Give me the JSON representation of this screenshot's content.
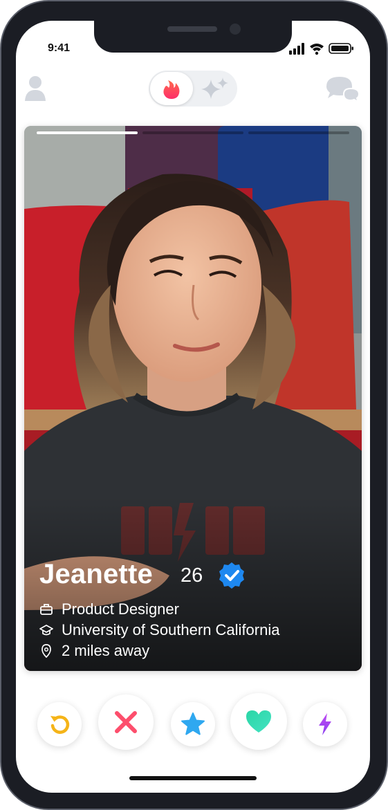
{
  "status_bar": {
    "time": "9:41"
  },
  "header": {
    "left_icon": "profile-icon",
    "toggle_left_icon": "flame-icon",
    "toggle_right_icon": "sparkle-icon",
    "right_icon": "messages-icon"
  },
  "card": {
    "progress": {
      "segments": 3,
      "active": 1
    },
    "name": "Jeanette",
    "age": "26",
    "verified": true,
    "details": [
      {
        "icon": "briefcase-icon",
        "text": "Product Designer"
      },
      {
        "icon": "graduation-cap-icon",
        "text": "University of Southern California"
      },
      {
        "icon": "location-pin-icon",
        "text": "2 miles away"
      }
    ]
  },
  "actions": [
    {
      "name": "rewind",
      "icon": "rewind-icon",
      "color": "#f5b418"
    },
    {
      "name": "nope",
      "icon": "close-icon",
      "color": "#fd4e6c"
    },
    {
      "name": "super-like",
      "icon": "star-icon",
      "color": "#2fa8f0"
    },
    {
      "name": "like",
      "icon": "heart-icon",
      "color": "#2ad6a6"
    },
    {
      "name": "boost",
      "icon": "lightning-icon",
      "color": "#a44ff0"
    }
  ],
  "colors": {
    "brand_flame": "#fd3a5f",
    "verified_blue": "#1e88f0",
    "inactive_icon": "#d3d7de"
  }
}
